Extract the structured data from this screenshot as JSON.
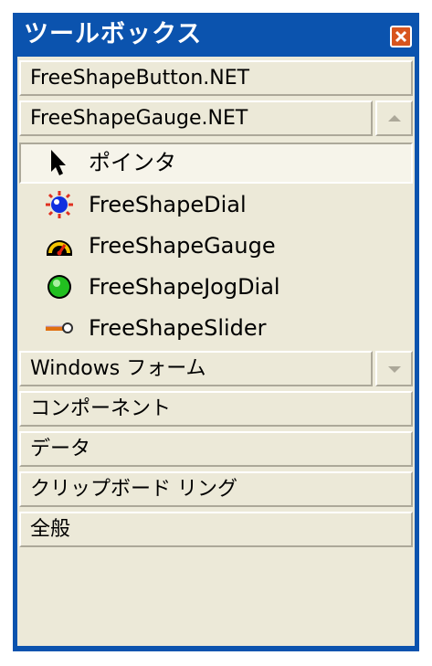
{
  "window": {
    "title": "ツールボックス",
    "close_icon": "close-icon"
  },
  "groups": {
    "button_net": "FreeShapeButton.NET",
    "gauge_net": "FreeShapeGauge.NET",
    "windows_forms": "Windows フォーム",
    "components": "コンポーネント",
    "data": "データ",
    "clipboard_ring": "クリップボード リング",
    "general": "全般"
  },
  "tools": [
    {
      "label": "ポインタ",
      "icon": "pointer-icon",
      "selected": true
    },
    {
      "label": "FreeShapeDial",
      "icon": "dial-icon"
    },
    {
      "label": "FreeShapeGauge",
      "icon": "gauge-icon"
    },
    {
      "label": "FreeShapeJogDial",
      "icon": "jogdial-icon"
    },
    {
      "label": "FreeShapeSlider",
      "icon": "slider-icon"
    }
  ],
  "colors": {
    "title_bar": "#0b53ae",
    "panel": "#ece9d8",
    "close_button": "#d8551e"
  }
}
